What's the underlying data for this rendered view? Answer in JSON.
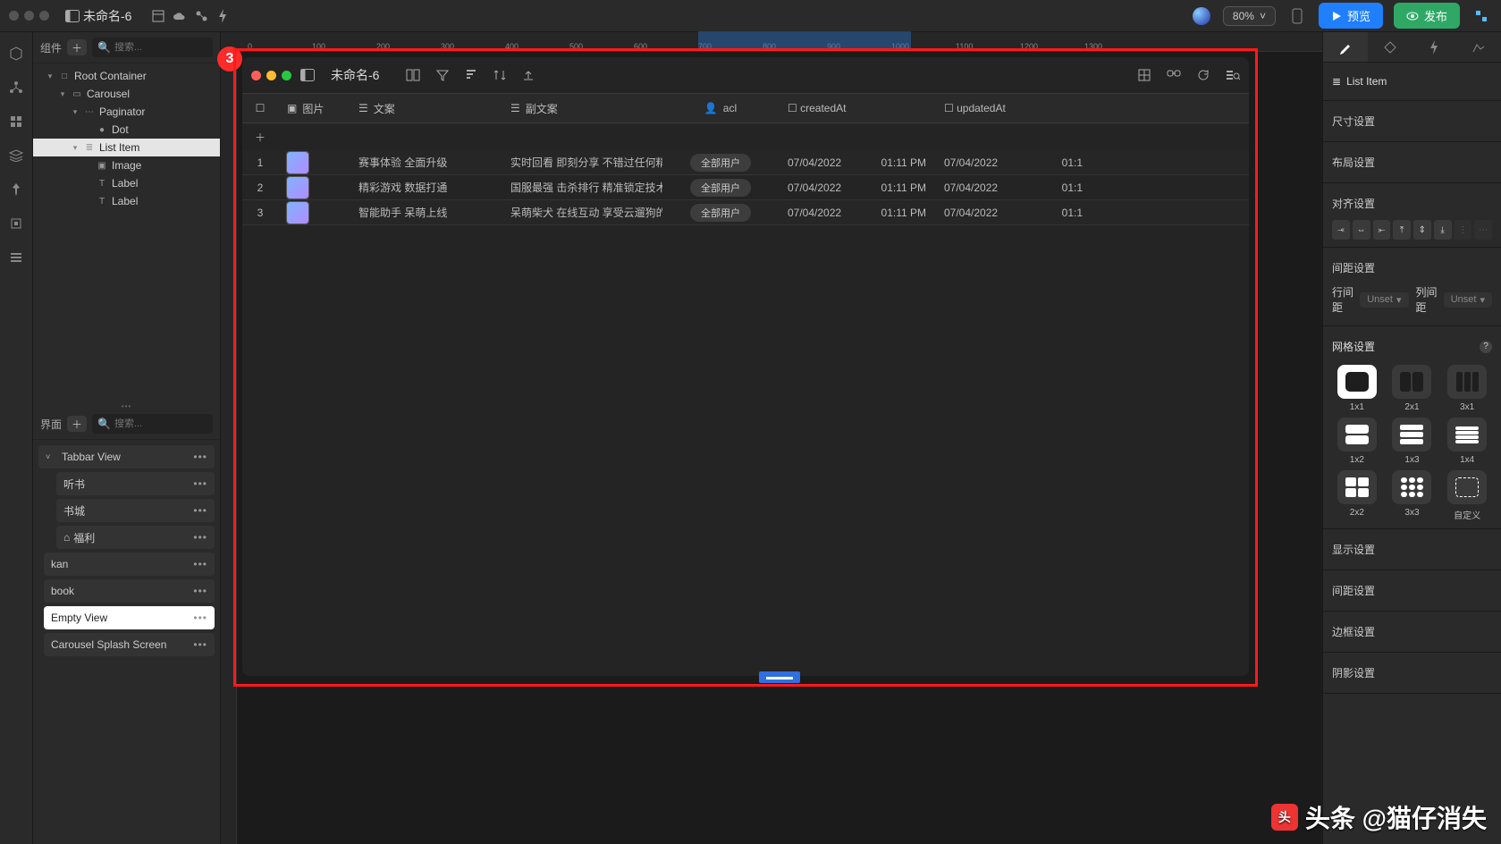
{
  "topbar": {
    "title": "未命名-6",
    "zoom": "80%",
    "preview": "预览",
    "publish": "发布"
  },
  "left": {
    "components_label": "组件",
    "search_placeholder": "搜索...",
    "scenes_label": "界面",
    "scenes_search": "搜索..."
  },
  "tree": [
    {
      "label": "Root Container",
      "depth": 1,
      "caret": "▾",
      "icon": "□"
    },
    {
      "label": "Carousel",
      "depth": 2,
      "caret": "▾",
      "icon": "▭"
    },
    {
      "label": "Paginator",
      "depth": 3,
      "caret": "▾",
      "icon": "⋯"
    },
    {
      "label": "Dot",
      "depth": 4,
      "caret": "",
      "icon": "●"
    },
    {
      "label": "List Item",
      "depth": 3,
      "caret": "▾",
      "icon": "≣",
      "sel": true
    },
    {
      "label": "Image",
      "depth": 4,
      "caret": "",
      "icon": "▣"
    },
    {
      "label": "Label",
      "depth": 4,
      "caret": "",
      "icon": "T"
    },
    {
      "label": "Label",
      "depth": 4,
      "caret": "",
      "icon": "T"
    }
  ],
  "scene_groups": [
    {
      "label": "Tabbar View",
      "chev": "˅",
      "items": [
        {
          "label": "听书"
        },
        {
          "label": "书城"
        },
        {
          "label": "福利",
          "icon": "⌂"
        }
      ]
    },
    {
      "label": "kan",
      "plain": true
    },
    {
      "label": "book",
      "plain": true
    },
    {
      "label": "Empty View",
      "plain": true,
      "active": true
    },
    {
      "label": "Carousel Splash Screen",
      "plain": true
    }
  ],
  "ruler_ticks": [
    0,
    100,
    200,
    300,
    400,
    500,
    600,
    700,
    800,
    900,
    1000,
    1100,
    1200,
    1300
  ],
  "ruler_sel": {
    "start": 700,
    "end": 1030
  },
  "badge": "3",
  "inner": {
    "title": "未命名-6",
    "columns": [
      {
        "key": "ck",
        "label": "",
        "icon": "☐"
      },
      {
        "key": "img",
        "label": "图片",
        "icon": "▣"
      },
      {
        "key": "t1",
        "label": "文案",
        "icon": "☰"
      },
      {
        "key": "t2",
        "label": "副文案",
        "icon": "☰"
      },
      {
        "key": "acl",
        "label": "acl",
        "icon": "👤"
      },
      {
        "key": "createdAt",
        "label": "createdAt",
        "icon": "☐"
      },
      {
        "key": "updatedAt",
        "label": "updatedAt",
        "icon": "☐"
      }
    ],
    "rows": [
      {
        "idx": "1",
        "t1": "赛事体验 全面升级",
        "t2": "实时回看 即刻分享 不错过任何精...",
        "acl": "全部用户",
        "created_d": "07/04/2022",
        "created_t": "01:11 PM",
        "updated_d": "07/04/2022",
        "updated_t": "01:1"
      },
      {
        "idx": "2",
        "t1": "精彩游戏 数据打通",
        "t2": "国服最强 击杀排行 精准锁定技术...",
        "acl": "全部用户",
        "created_d": "07/04/2022",
        "created_t": "01:11 PM",
        "updated_d": "07/04/2022",
        "updated_t": "01:1"
      },
      {
        "idx": "3",
        "t1": "智能助手 呆萌上线",
        "t2": "呆萌柴犬 在线互动 享受云遛狗的...",
        "acl": "全部用户",
        "created_d": "07/04/2022",
        "created_t": "01:11 PM",
        "updated_d": "07/04/2022",
        "updated_t": "01:1"
      }
    ]
  },
  "inspector": {
    "title": "List Item",
    "size": "尺寸设置",
    "layout": "布局设置",
    "align": "对齐设置",
    "spacing": "间距设置",
    "row_gap_label": "行间距",
    "row_gap_val": "Unset",
    "col_gap_label": "列间距",
    "col_gap_val": "Unset",
    "grid": "网格设置",
    "grid_opts": [
      "1x1",
      "2x1",
      "3x1",
      "1x2",
      "1x3",
      "1x4",
      "2x2",
      "3x3",
      "自定义"
    ],
    "display": "显示设置",
    "spacing2": "间距设置",
    "border": "边框设置",
    "shadow": "阴影设置"
  },
  "watermark": "头条 @猫仔消失"
}
